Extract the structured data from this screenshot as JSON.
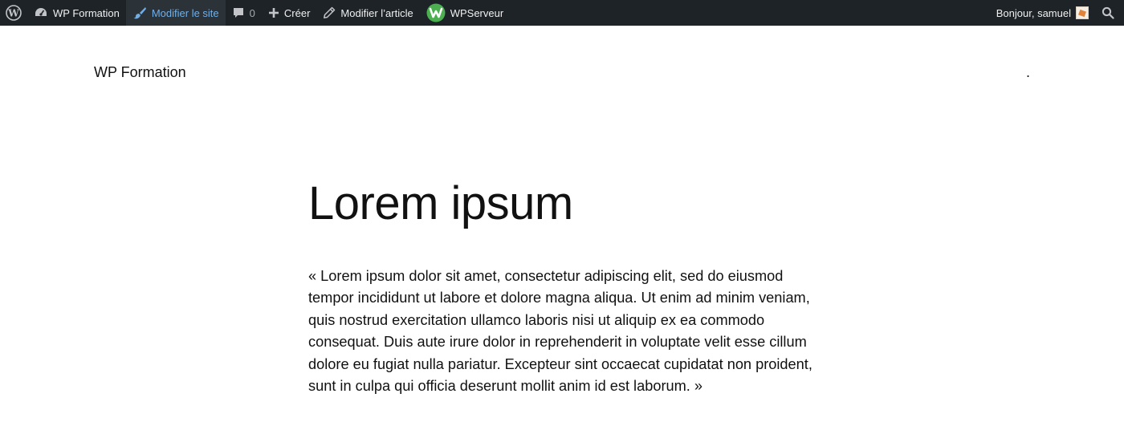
{
  "adminbar": {
    "site_name": "WP Formation",
    "customize_label": "Modifier le site",
    "comments_count": "0",
    "new_label": "Créer",
    "edit_label": "Modifier l’article",
    "wpserveur_label": "WPServeur",
    "greeting": "Bonjour, samuel",
    "colors": {
      "background": "#1d2327",
      "active_background": "#2c3338",
      "active_text": "#72aee6",
      "wpserveur_green": "#4caf50"
    }
  },
  "header": {
    "site_title": "WP Formation",
    "menu_placeholder": "."
  },
  "post": {
    "title": "Lorem ipsum",
    "content": "« Lorem ipsum dolor sit amet, consectetur adipiscing elit, sed do eiusmod tempor incididunt ut labore et dolore magna aliqua. Ut enim ad minim veniam, quis nostrud exercitation ullamco laboris nisi ut aliquip ex ea commodo consequat. Duis aute irure dolor in reprehenderit in voluptate velit esse cillum dolore eu fugiat nulla pariatur. Excepteur sint occaecat cupidatat non proident, sunt in culpa qui officia deserunt mollit anim id est laborum. »"
  },
  "icons": {
    "wp_logo": "wordpress-logo-icon",
    "dashboard": "dashboard-icon",
    "customize": "brush-icon",
    "comments": "comment-bubble-icon",
    "new": "plus-icon",
    "edit": "pencil-icon",
    "wpserveur": "wpserveur-logo-icon",
    "search": "search-icon"
  }
}
